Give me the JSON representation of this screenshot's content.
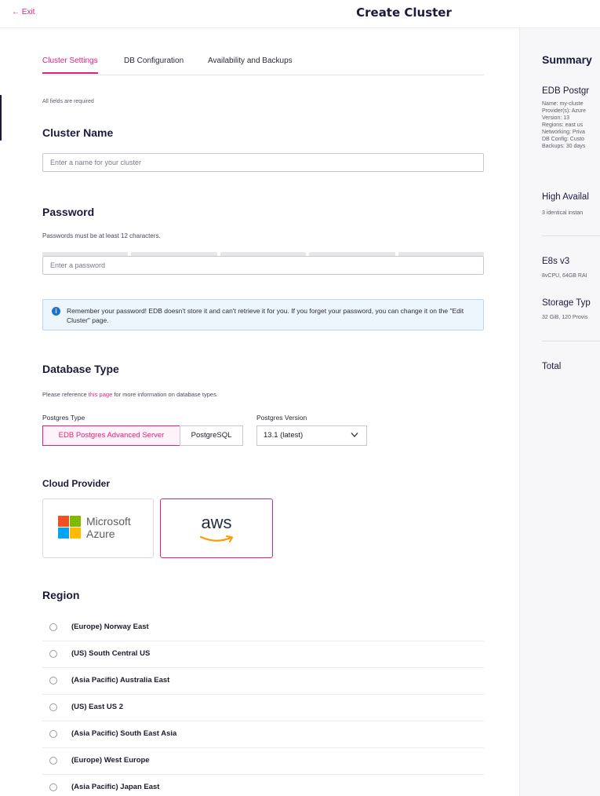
{
  "header": {
    "exit_label": "← Exit",
    "title": "Create Cluster"
  },
  "tabs": [
    {
      "label": "Cluster Settings",
      "active": true
    },
    {
      "label": "DB Configuration",
      "active": false
    },
    {
      "label": "Availability and Backups",
      "active": false
    }
  ],
  "form": {
    "required_note": "All fields are required",
    "cluster_name": {
      "heading": "Cluster Name",
      "placeholder": "Enter a name for your cluster"
    },
    "password": {
      "heading": "Password",
      "hint": "Passwords must be at least 12 characters.",
      "placeholder": "Enter a password",
      "notice": "Remember your password! EDB doesn't store it and can't retrieve it for you. If you forget your password, you can change it on the \"Edit Cluster\" page."
    },
    "database_type": {
      "heading": "Database Type",
      "hint_prefix": "Please reference ",
      "hint_link": "this page",
      "hint_suffix": " for more information on database types.",
      "postgres_type_label": "Postgres Type",
      "option_advanced": "EDB Postgres Advanced Server",
      "option_postgresql": "PostgreSQL",
      "postgres_version_label": "Postgres Version",
      "postgres_version_value": "13.1 (latest)"
    },
    "cloud_provider": {
      "heading": "Cloud Provider",
      "azure_line1": "Microsoft",
      "azure_line2": "Azure",
      "aws_label": "aws"
    },
    "region": {
      "heading": "Region",
      "options": [
        "(Europe) Norway East",
        "(US) South Central US",
        "(Asia Pacific) Australia East",
        "(US) East US 2",
        "(Asia Pacific) South East Asia",
        "(Europe) West Europe",
        "(Asia Pacific) Japan East"
      ]
    }
  },
  "summary": {
    "title": "Summary",
    "db_heading": "EDB Postgr",
    "db_lines": [
      "Name: my-cluste",
      "Provider(s): Azure",
      "Version: 13",
      "Regions: east us",
      "Networking: Priva",
      "DB Config: Custo",
      "Backups: 30 days"
    ],
    "ha_heading": "High Availal",
    "ha_line": "3 identical instan",
    "instance_heading": "E8s v3",
    "instance_line": "8vCPU, 64GB RAI",
    "storage_heading": "Storage Typ",
    "storage_line": "32 GiB, 120 Provis",
    "total_label": "Total"
  },
  "colors": {
    "accent": "#e0217f",
    "info": "#1d73c9",
    "heading": "#1a1a3c"
  },
  "icons": [
    "arrow-left-icon",
    "info-icon",
    "chevron-down-icon",
    "microsoft-logo-icon",
    "aws-smile-icon"
  ]
}
